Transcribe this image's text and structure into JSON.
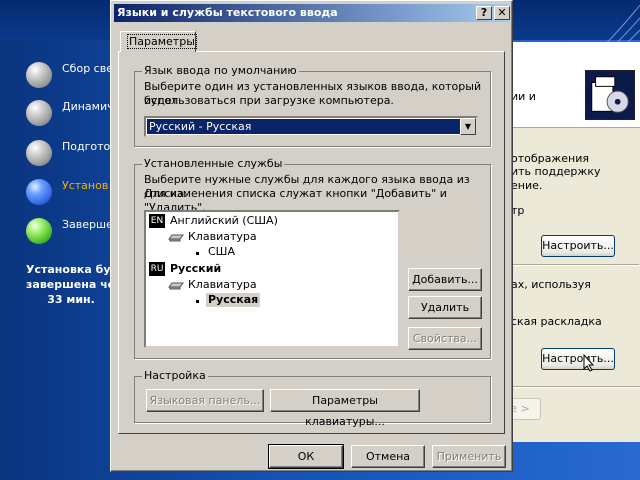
{
  "setup_sidebar": {
    "steps": [
      {
        "label": "Сбор сведени",
        "state": "done"
      },
      {
        "label": "Динамич обновле",
        "state": "done"
      },
      {
        "label": "Подгото установ",
        "state": "done"
      },
      {
        "label": "Установ Windows",
        "state": "active"
      },
      {
        "label": "Завершен установк",
        "state": "pending"
      }
    ],
    "remaining_line1": "Установка буд",
    "remaining_line2": "завершена чер",
    "remaining_line3": "33 мин."
  },
  "back_window": {
    "header_text_1": "ии и",
    "text_1": "отображения",
    "text_2": "ить поддержку",
    "text_3": "ение.",
    "text_4": "тр",
    "btn_configure_1": "Настроить...",
    "text_5": "ах, используя",
    "text_6": "ская раскладка",
    "btn_configure_2": "Настроить...",
    "nav_fragment": "е >"
  },
  "dialog": {
    "title": "Языки и службы текстового ввода",
    "help_btn": "?",
    "close_btn": "✕",
    "tab_label": "Параметры",
    "default_lang": {
      "legend": "Язык ввода по умолчанию",
      "desc_1": "Выберите один из установленных языков ввода, который будет",
      "desc_2": "использоваться при загрузке компьютера.",
      "selected": "Русский - Русская",
      "arrow": "▼"
    },
    "services": {
      "legend": "Установленные службы",
      "desc_1": "Выберите нужные службы для каждого языка ввода из списка.",
      "desc_2": "Для изменения списка служат кнопки \"Добавить\" и \"Удалить\".",
      "tree": {
        "lang1_code": "EN",
        "lang1_name": "Английский (США)",
        "lang1_kb": "Клавиатура",
        "lang1_layout": "США",
        "lang2_code": "RU",
        "lang2_name": "Русский",
        "lang2_kb": "Клавиатура",
        "lang2_layout": "Русская"
      },
      "add_btn": "Добавить...",
      "remove_btn": "Удалить",
      "props_btn": "Свойства..."
    },
    "settings": {
      "legend": "Настройка",
      "langbar_btn": "Языковая панель...",
      "keyboard_btn": "Параметры клавиатуры..."
    },
    "ok_btn": "ОК",
    "cancel_btn": "Отмена",
    "apply_btn": "Применить"
  },
  "colors": {
    "title_start": "#0a246a",
    "title_end": "#a6caf0",
    "selection": "#0a246a",
    "active_step": "#f5b400"
  }
}
